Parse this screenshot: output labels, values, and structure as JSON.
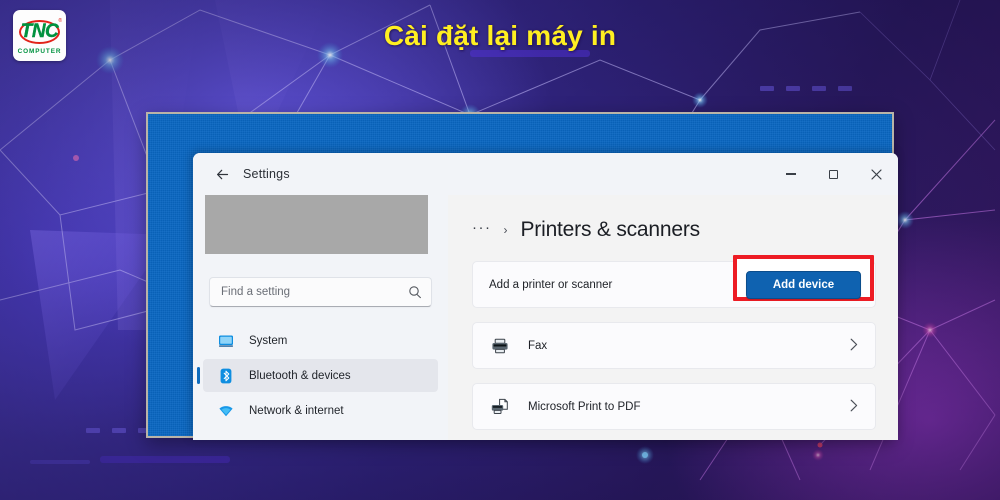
{
  "brand": {
    "logo_main": "TNC",
    "logo_sub": "COMPUTER",
    "logo_reg": "®",
    "logo_green": "#00923f",
    "logo_red": "#e2231a"
  },
  "banner": {
    "heading": "Cài đặt lại máy in",
    "heading_color": "#ffef21"
  },
  "window": {
    "title": "Settings",
    "back_icon": "back-arrow-icon",
    "controls": {
      "minimize": "—",
      "maximize": "▢",
      "close": "✕"
    }
  },
  "sidebar": {
    "profile_placeholder": "",
    "search": {
      "placeholder": "Find a setting",
      "icon": "search-icon"
    },
    "items": [
      {
        "label": "System",
        "icon": "monitor-icon",
        "active": false
      },
      {
        "label": "Bluetooth & devices",
        "icon": "bluetooth-icon",
        "active": true
      },
      {
        "label": "Network & internet",
        "icon": "wifi-icon",
        "active": false
      }
    ]
  },
  "content": {
    "breadcrumb": {
      "overflow": "···",
      "separator": "›",
      "title": "Printers & scanners"
    },
    "add_printer": {
      "label": "Add a printer or scanner",
      "button_label": "Add device",
      "button_color": "#0f62b0",
      "highlight_color": "#ed1c24"
    },
    "devices": [
      {
        "name": "Fax",
        "icon": "printer-icon",
        "chevron": "›"
      },
      {
        "name": "Microsoft Print to PDF",
        "icon": "printer-pdf-icon",
        "chevron": "›"
      }
    ]
  }
}
